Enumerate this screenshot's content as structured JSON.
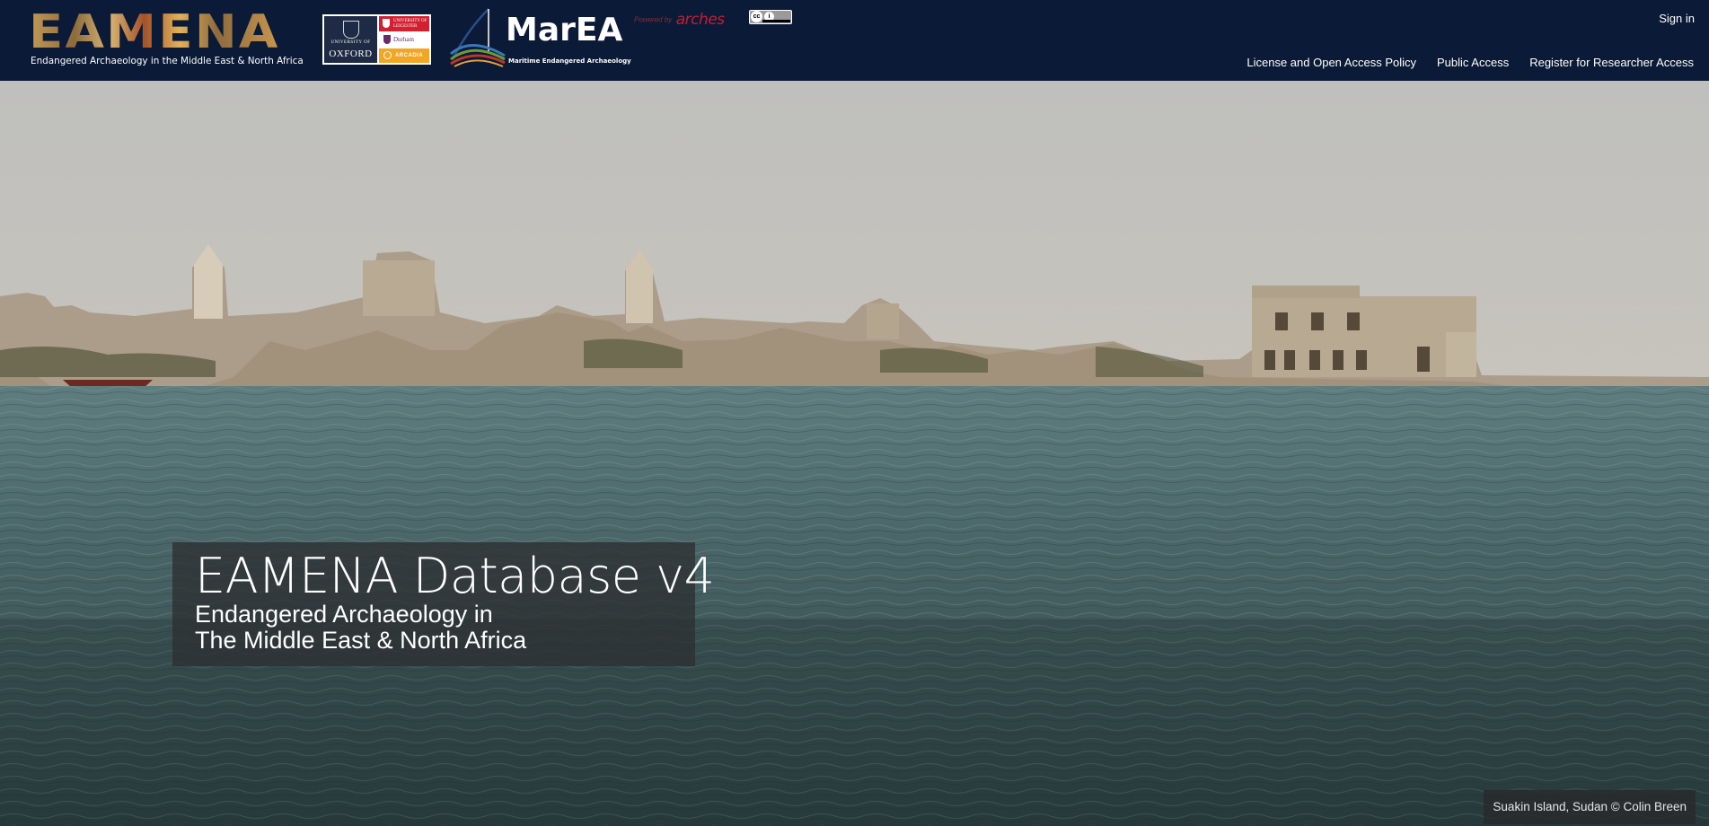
{
  "header": {
    "eamena_logo": {
      "word": "EAMENA",
      "tagline": "Endangered Archaeology in the Middle East & North Africa"
    },
    "partner_logos": {
      "oxford_line1": "UNIVERSITY OF",
      "oxford_line2": "OXFORD",
      "leicester": "UNIVERSITY OF LEICESTER",
      "durham": "Durham",
      "arcadia": "ARCADIA"
    },
    "marea_logo": {
      "word": "MarEA",
      "tagline": "Maritime Endangered Archaeology"
    },
    "powered_by": {
      "prefix": "Powered by",
      "name": "arches"
    },
    "license_badge": {
      "c1": "cc",
      "c2": "i"
    },
    "sign_in": "Sign in",
    "nav": [
      {
        "label": "License and Open Access Policy"
      },
      {
        "label": "Public Access"
      },
      {
        "label": "Register for Researcher Access"
      }
    ]
  },
  "hero": {
    "title": "EAMENA Database v4",
    "subtitle_line1": "Endangered Archaeology in",
    "subtitle_line2": "The Middle East & North Africa",
    "photo_credit": "Suakin Island, Sudan © Colin Breen"
  },
  "colors": {
    "header_bg": "#0b1a36",
    "arches_red": "#c11f35",
    "overlay": "#2d3032"
  }
}
